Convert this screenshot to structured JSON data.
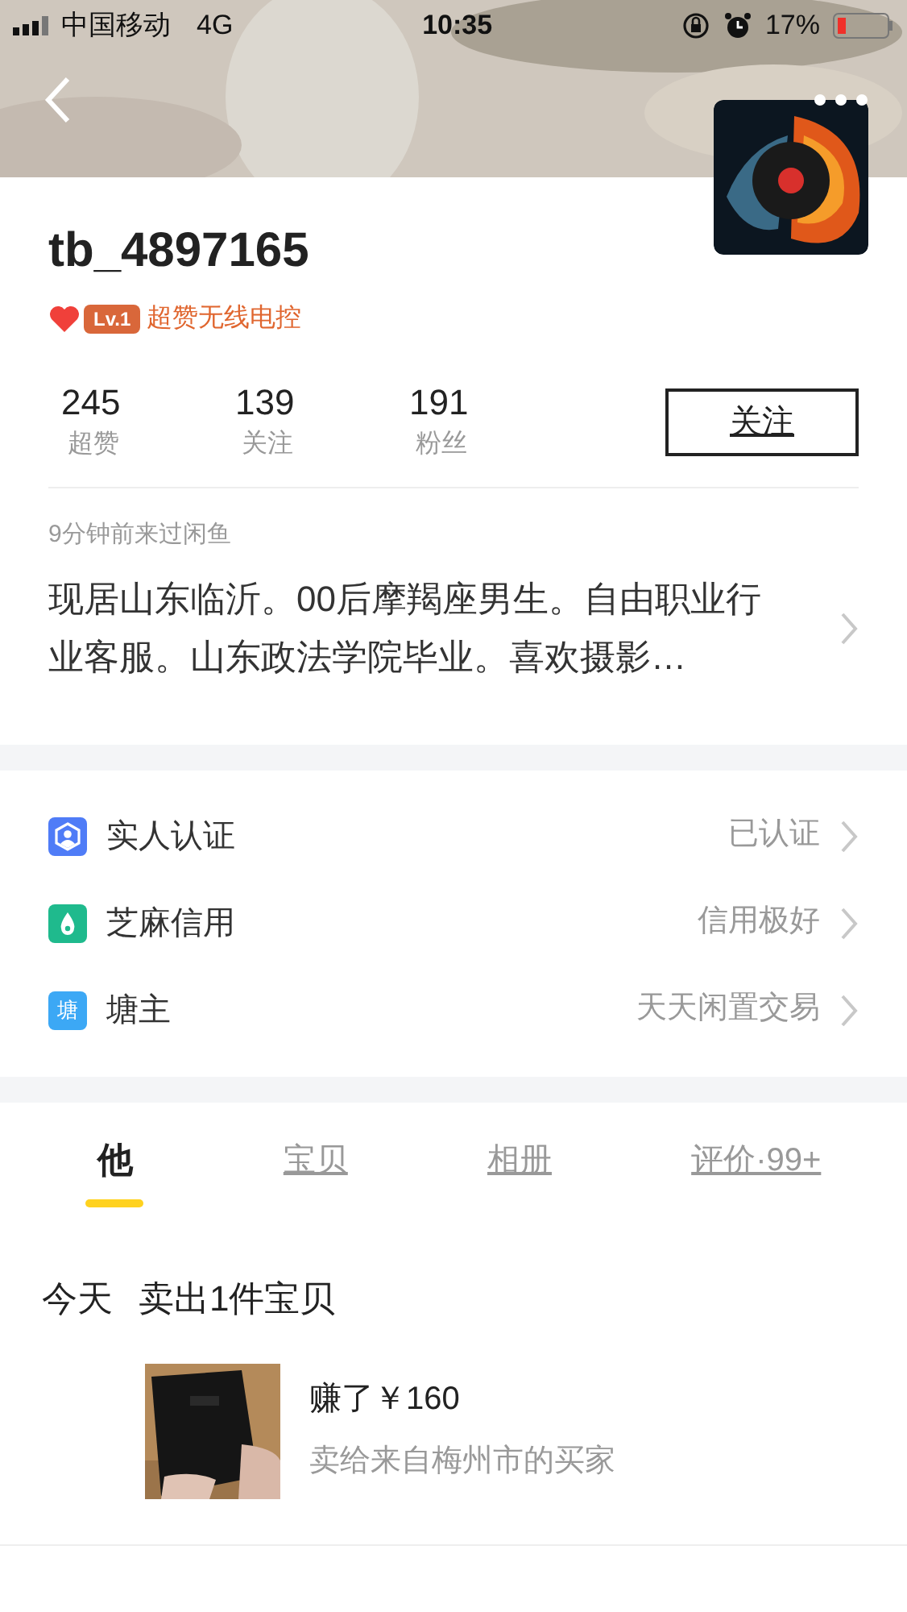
{
  "status_bar": {
    "carrier": "中国移动",
    "network": "4G",
    "time": "10:35",
    "battery": "17%"
  },
  "profile": {
    "username": "tb_4897165",
    "badge_level": "Lv.1",
    "badge_title": "超赞无线电控",
    "stats": [
      {
        "value": "245",
        "label": "超赞"
      },
      {
        "value": "139",
        "label": "关注"
      },
      {
        "value": "191",
        "label": "粉丝"
      }
    ],
    "follow_button": "关注",
    "last_seen": "9分钟前来过闲鱼",
    "bio": "现居山东临沂。00后摩羯座男生。自由职业行业客服。山东政法学院毕业。喜欢摄影…"
  },
  "info_rows": [
    {
      "kind": "verify",
      "label": "实人认证",
      "value": "已认证"
    },
    {
      "kind": "credit",
      "label": "芝麻信用",
      "value": "信用极好"
    },
    {
      "kind": "pond",
      "icon_text": "塘",
      "label": "塘主",
      "value": "天天闲置交易"
    }
  ],
  "tabs": [
    {
      "label": "他",
      "selected": true
    },
    {
      "label": "宝贝",
      "selected": false
    },
    {
      "label": "相册",
      "selected": false
    },
    {
      "label": "评价·99+",
      "selected": false
    }
  ],
  "feed": {
    "day": "今天",
    "summary": "卖出1件宝贝",
    "items": [
      {
        "kind": "picture",
        "earned": "赚了￥160",
        "buyer": "卖给来自梅州市的买家"
      }
    ]
  }
}
